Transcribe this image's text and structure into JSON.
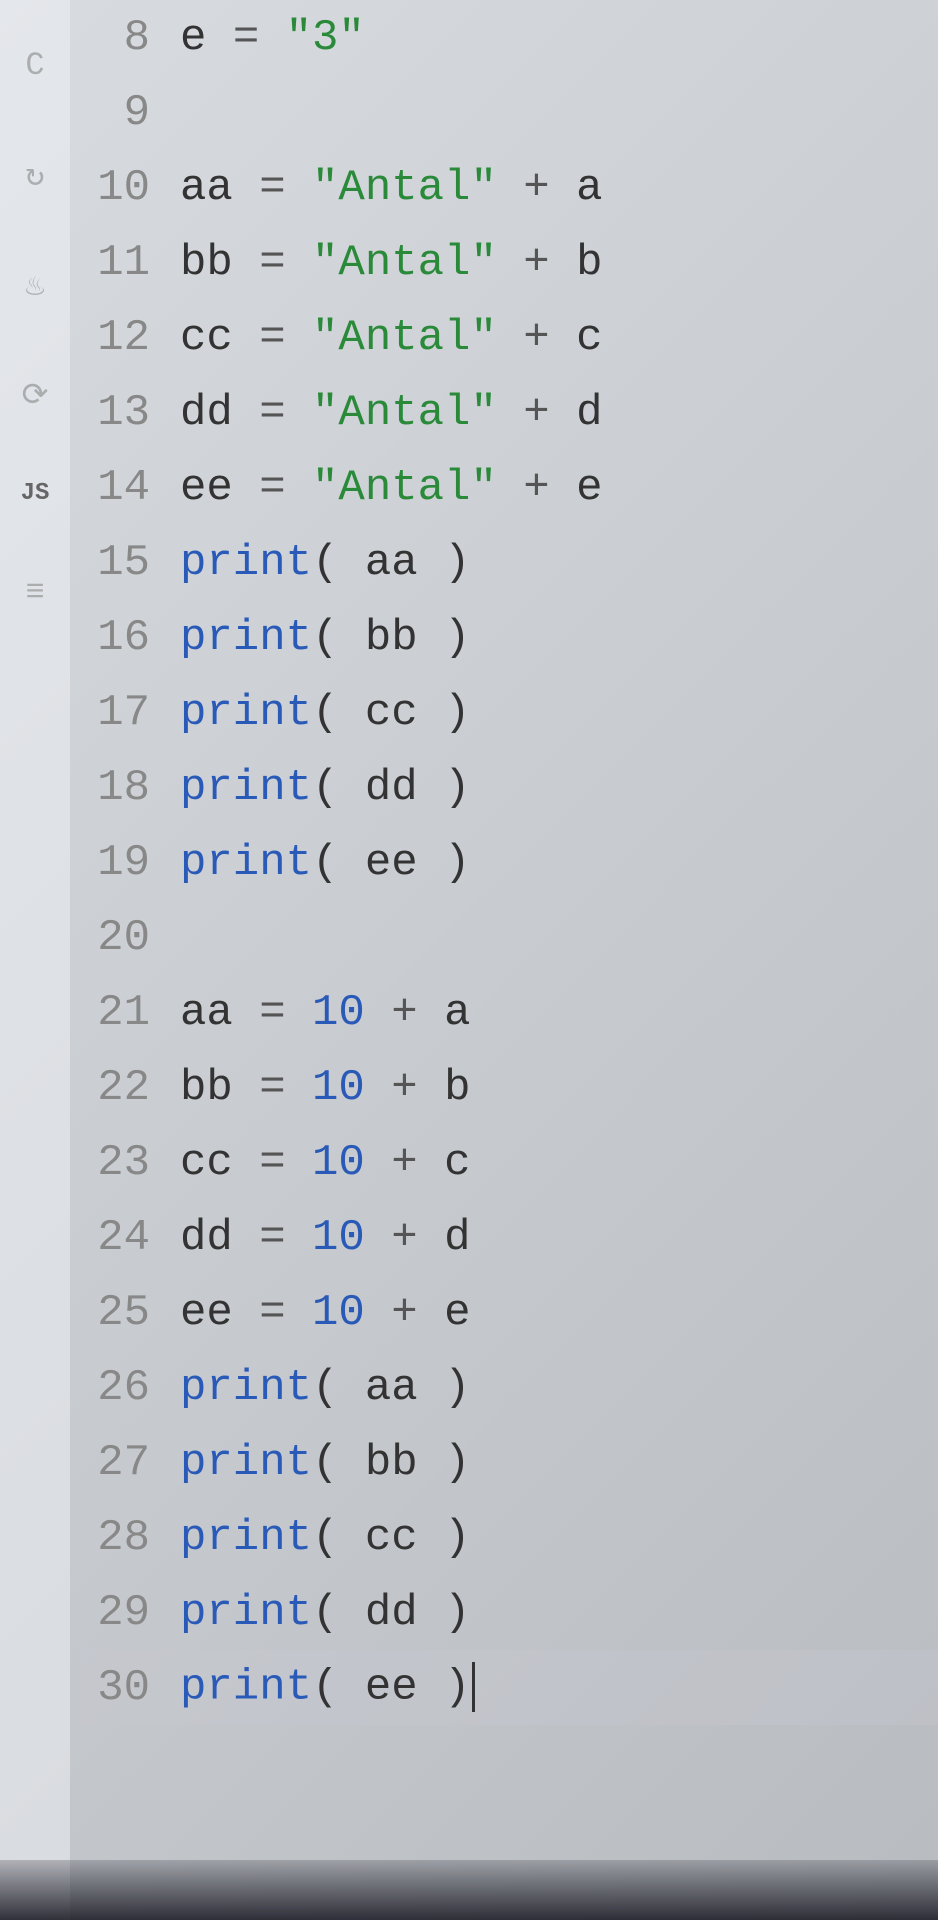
{
  "sidebar": {
    "icons": [
      {
        "name": "c-lang-icon",
        "glyph": "C"
      },
      {
        "name": "refresh-icon",
        "glyph": "↻"
      },
      {
        "name": "java-icon",
        "glyph": "♨"
      },
      {
        "name": "cpp-icon",
        "glyph": "⟳"
      }
    ],
    "label": "JS",
    "db_icon": "≡"
  },
  "code": {
    "lines": [
      {
        "num": "8",
        "tokens": [
          {
            "t": "identifier",
            "v": "e "
          },
          {
            "t": "operator",
            "v": "= "
          },
          {
            "t": "string",
            "v": "\"3\""
          }
        ]
      },
      {
        "num": "9",
        "tokens": []
      },
      {
        "num": "10",
        "tokens": [
          {
            "t": "identifier",
            "v": "aa "
          },
          {
            "t": "operator",
            "v": "= "
          },
          {
            "t": "string",
            "v": "\"Antal\""
          },
          {
            "t": "operator",
            "v": " + "
          },
          {
            "t": "identifier",
            "v": "a"
          }
        ]
      },
      {
        "num": "11",
        "tokens": [
          {
            "t": "identifier",
            "v": "bb "
          },
          {
            "t": "operator",
            "v": "= "
          },
          {
            "t": "string",
            "v": "\"Antal\""
          },
          {
            "t": "operator",
            "v": " + "
          },
          {
            "t": "identifier",
            "v": "b"
          }
        ]
      },
      {
        "num": "12",
        "tokens": [
          {
            "t": "identifier",
            "v": "cc "
          },
          {
            "t": "operator",
            "v": "= "
          },
          {
            "t": "string",
            "v": "\"Antal\""
          },
          {
            "t": "operator",
            "v": " + "
          },
          {
            "t": "identifier",
            "v": "c"
          }
        ]
      },
      {
        "num": "13",
        "tokens": [
          {
            "t": "identifier",
            "v": "dd "
          },
          {
            "t": "operator",
            "v": "= "
          },
          {
            "t": "string",
            "v": "\"Antal\""
          },
          {
            "t": "operator",
            "v": " + "
          },
          {
            "t": "identifier",
            "v": "d"
          }
        ]
      },
      {
        "num": "14",
        "tokens": [
          {
            "t": "identifier",
            "v": "ee "
          },
          {
            "t": "operator",
            "v": "= "
          },
          {
            "t": "string",
            "v": "\"Antal\""
          },
          {
            "t": "operator",
            "v": " + "
          },
          {
            "t": "identifier",
            "v": "e"
          }
        ]
      },
      {
        "num": "15",
        "tokens": [
          {
            "t": "function",
            "v": "print"
          },
          {
            "t": "paren",
            "v": "( "
          },
          {
            "t": "identifier",
            "v": "aa"
          },
          {
            "t": "paren",
            "v": " )"
          }
        ]
      },
      {
        "num": "16",
        "tokens": [
          {
            "t": "function",
            "v": "print"
          },
          {
            "t": "paren",
            "v": "( "
          },
          {
            "t": "identifier",
            "v": "bb"
          },
          {
            "t": "paren",
            "v": " )"
          }
        ]
      },
      {
        "num": "17",
        "tokens": [
          {
            "t": "function",
            "v": "print"
          },
          {
            "t": "paren",
            "v": "( "
          },
          {
            "t": "identifier",
            "v": "cc"
          },
          {
            "t": "paren",
            "v": " )"
          }
        ]
      },
      {
        "num": "18",
        "tokens": [
          {
            "t": "function",
            "v": "print"
          },
          {
            "t": "paren",
            "v": "( "
          },
          {
            "t": "identifier",
            "v": "dd"
          },
          {
            "t": "paren",
            "v": " )"
          }
        ]
      },
      {
        "num": "19",
        "tokens": [
          {
            "t": "function",
            "v": "print"
          },
          {
            "t": "paren",
            "v": "( "
          },
          {
            "t": "identifier",
            "v": "ee"
          },
          {
            "t": "paren",
            "v": " )"
          }
        ]
      },
      {
        "num": "20",
        "tokens": []
      },
      {
        "num": "21",
        "tokens": [
          {
            "t": "identifier",
            "v": "aa "
          },
          {
            "t": "operator",
            "v": "= "
          },
          {
            "t": "number",
            "v": "10"
          },
          {
            "t": "operator",
            "v": " + "
          },
          {
            "t": "identifier",
            "v": "a"
          }
        ]
      },
      {
        "num": "22",
        "tokens": [
          {
            "t": "identifier",
            "v": "bb "
          },
          {
            "t": "operator",
            "v": "= "
          },
          {
            "t": "number",
            "v": "10"
          },
          {
            "t": "operator",
            "v": " + "
          },
          {
            "t": "identifier",
            "v": "b"
          }
        ]
      },
      {
        "num": "23",
        "tokens": [
          {
            "t": "identifier",
            "v": "cc "
          },
          {
            "t": "operator",
            "v": "= "
          },
          {
            "t": "number",
            "v": "10"
          },
          {
            "t": "operator",
            "v": " + "
          },
          {
            "t": "identifier",
            "v": "c"
          }
        ]
      },
      {
        "num": "24",
        "tokens": [
          {
            "t": "identifier",
            "v": "dd "
          },
          {
            "t": "operator",
            "v": "= "
          },
          {
            "t": "number",
            "v": "10"
          },
          {
            "t": "operator",
            "v": " + "
          },
          {
            "t": "identifier",
            "v": "d"
          }
        ]
      },
      {
        "num": "25",
        "tokens": [
          {
            "t": "identifier",
            "v": "ee "
          },
          {
            "t": "operator",
            "v": "= "
          },
          {
            "t": "number",
            "v": "10"
          },
          {
            "t": "operator",
            "v": " + "
          },
          {
            "t": "identifier",
            "v": "e"
          }
        ]
      },
      {
        "num": "26",
        "tokens": [
          {
            "t": "function",
            "v": "print"
          },
          {
            "t": "paren",
            "v": "( "
          },
          {
            "t": "identifier",
            "v": "aa"
          },
          {
            "t": "paren",
            "v": " )"
          }
        ]
      },
      {
        "num": "27",
        "tokens": [
          {
            "t": "function",
            "v": "print"
          },
          {
            "t": "paren",
            "v": "( "
          },
          {
            "t": "identifier",
            "v": "bb"
          },
          {
            "t": "paren",
            "v": " )"
          }
        ]
      },
      {
        "num": "28",
        "tokens": [
          {
            "t": "function",
            "v": "print"
          },
          {
            "t": "paren",
            "v": "( "
          },
          {
            "t": "identifier",
            "v": "cc"
          },
          {
            "t": "paren",
            "v": " )"
          }
        ]
      },
      {
        "num": "29",
        "tokens": [
          {
            "t": "function",
            "v": "print"
          },
          {
            "t": "paren",
            "v": "( "
          },
          {
            "t": "identifier",
            "v": "dd"
          },
          {
            "t": "paren",
            "v": " )"
          }
        ]
      },
      {
        "num": "30",
        "tokens": [
          {
            "t": "function",
            "v": "print"
          },
          {
            "t": "paren",
            "v": "( "
          },
          {
            "t": "identifier",
            "v": "ee"
          },
          {
            "t": "paren",
            "v": " )"
          }
        ],
        "cursor": true,
        "current": true
      }
    ]
  }
}
